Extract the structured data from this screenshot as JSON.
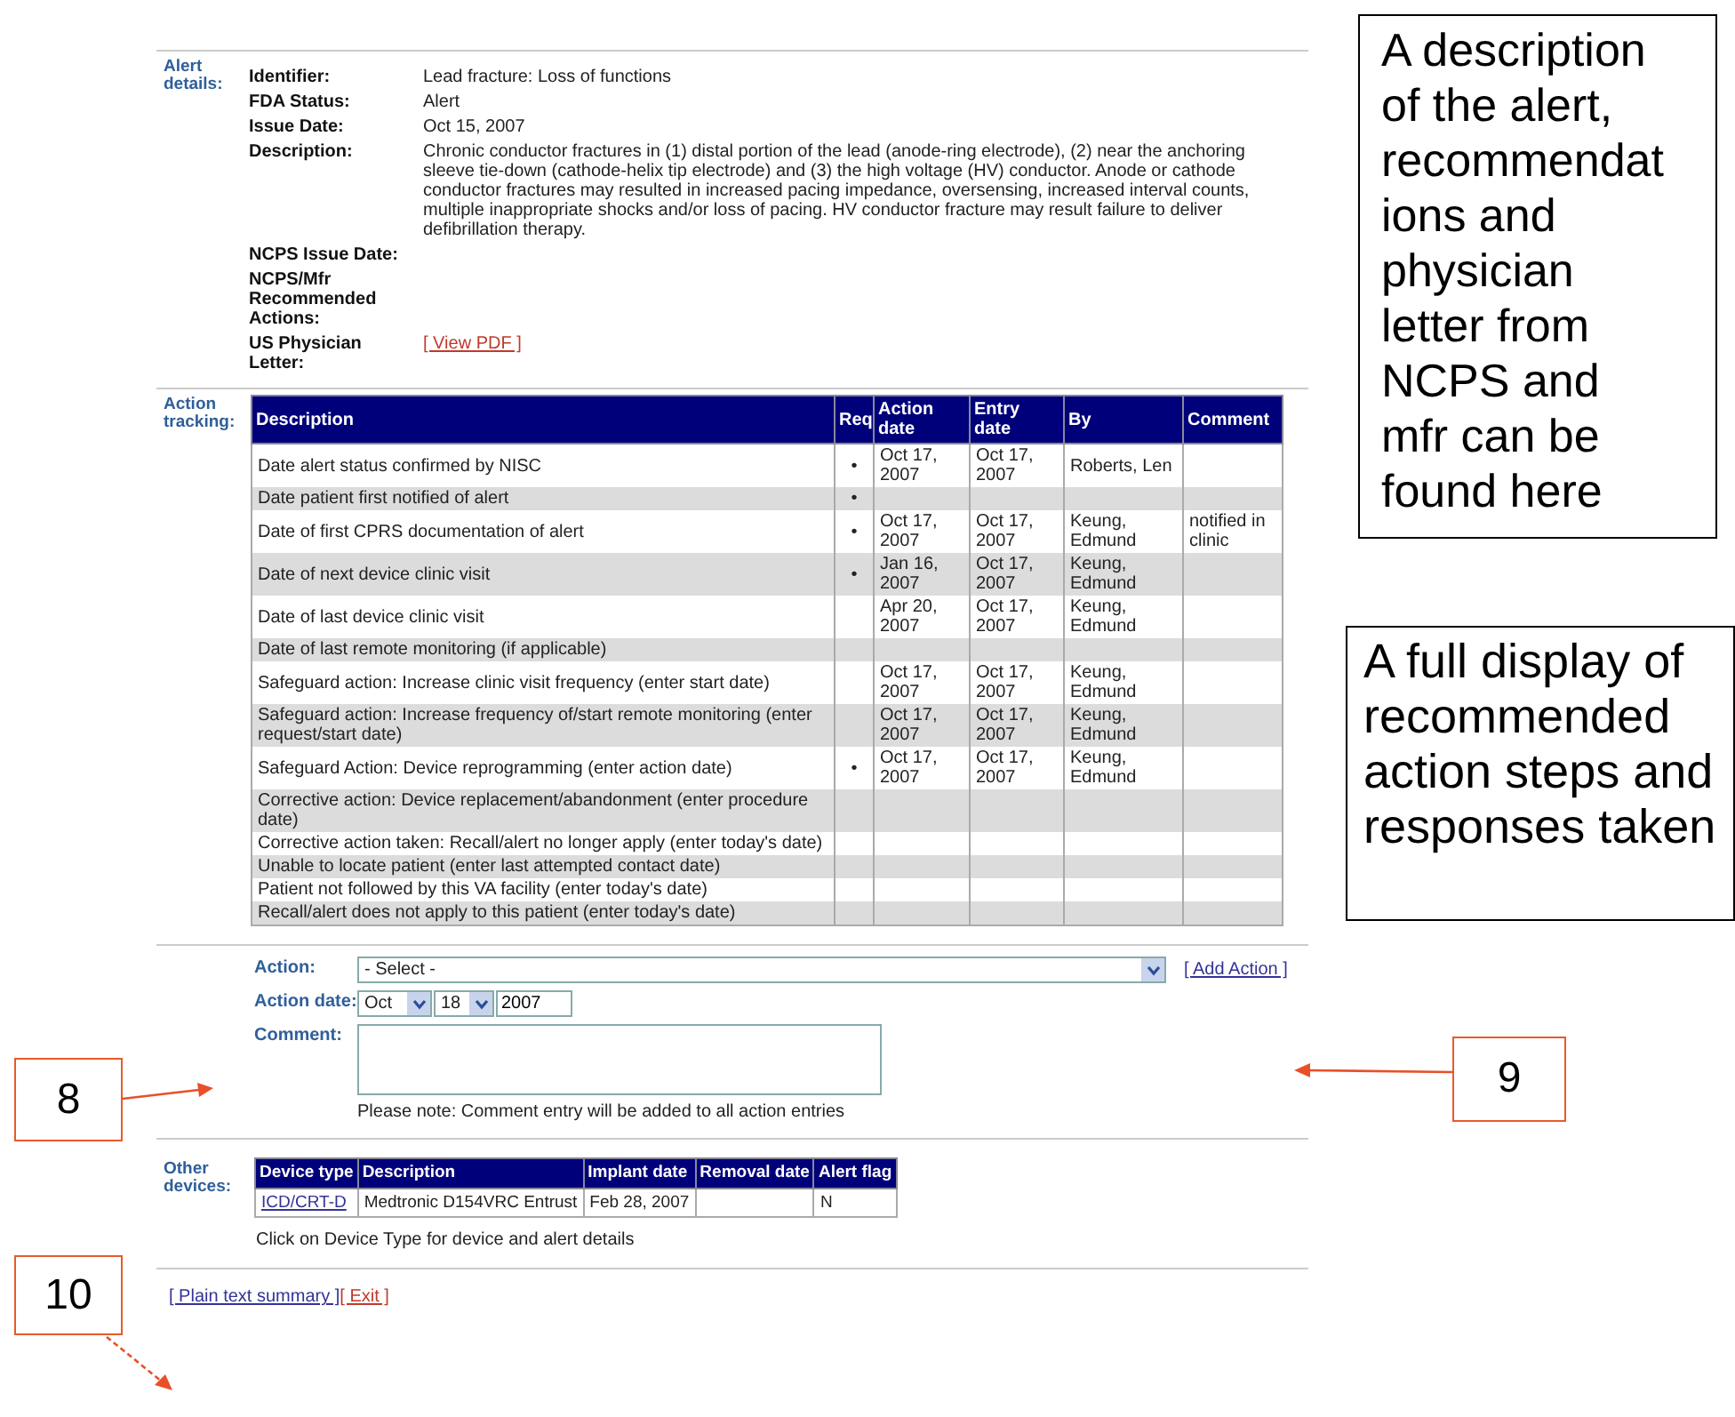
{
  "alert_details": {
    "section_label": "Alert details:",
    "fields": [
      {
        "label": "Identifier:",
        "value": "Lead fracture: Loss of functions",
        "kind": "text"
      },
      {
        "label": "FDA Status:",
        "value": "Alert",
        "kind": "text"
      },
      {
        "label": "Issue Date:",
        "value": "Oct 15, 2007",
        "kind": "text"
      },
      {
        "label": "Description:",
        "value": "Chronic conductor fractures in (1) distal portion of the lead (anode-ring electrode), (2) near the anchoring sleeve tie-down (cathode-helix tip electrode) and (3) the high voltage (HV) conductor. Anode or cathode conductor fractures may resulted in increased pacing impedance, oversensing, increased interval counts, multiple inappropriate shocks and/or loss of pacing. HV conductor fracture may result failure to deliver defibrillation therapy.",
        "kind": "text"
      },
      {
        "label": "NCPS Issue Date:",
        "kind": "text"
      },
      {
        "label": "NCPS/Mfr Recommended Actions:",
        "kind": "text"
      },
      {
        "label": "US Physician Letter:",
        "value": "[ View PDF ]",
        "kind": "link"
      }
    ]
  },
  "action_tracking": {
    "section_label": "Action tracking:",
    "columns": [
      "Description",
      "Req",
      "Action date",
      "Entry date",
      "By",
      "Comment"
    ],
    "rows": [
      {
        "description": "Date alert status confirmed by NISC",
        "req": "•",
        "action_date": "Oct 17, 2007",
        "entry_date": "Oct 17, 2007",
        "by": "Roberts, Len"
      },
      {
        "description": "Date patient first notified of alert",
        "req": "•"
      },
      {
        "description": "Date of first CPRS documentation of alert",
        "req": "•",
        "action_date": "Oct 17, 2007",
        "entry_date": "Oct 17, 2007",
        "by": "Keung, Edmund",
        "comment": "notified in clinic"
      },
      {
        "description": "Date of next device clinic visit",
        "req": "•",
        "action_date": "Jan 16, 2007",
        "entry_date": "Oct 17, 2007",
        "by": "Keung, Edmund"
      },
      {
        "description": "Date of last device clinic visit",
        "action_date": "Apr 20, 2007",
        "entry_date": "Oct 17, 2007",
        "by": "Keung, Edmund"
      },
      {
        "description": "Date of last remote monitoring (if applicable)"
      },
      {
        "description": "Safeguard action: Increase clinic visit frequency (enter start date)",
        "action_date": "Oct 17, 2007",
        "entry_date": "Oct 17, 2007",
        "by": "Keung, Edmund"
      },
      {
        "description": "Safeguard action: Increase frequency of/start remote monitoring (enter request/start date)",
        "action_date": "Oct 17, 2007",
        "entry_date": "Oct 17, 2007",
        "by": "Keung, Edmund"
      },
      {
        "description": "Safeguard Action: Device reprogramming (enter action date)",
        "req": "•",
        "action_date": "Oct 17, 2007",
        "entry_date": "Oct 17, 2007",
        "by": "Keung, Edmund"
      },
      {
        "description": "Corrective action: Device replacement/abandonment (enter procedure date)"
      },
      {
        "description": "Corrective action taken: Recall/alert no longer apply (enter today's date)"
      },
      {
        "description": "Unable to locate patient (enter last attempted contact date)"
      },
      {
        "description": "Patient not followed by this VA facility (enter today's date)"
      },
      {
        "description": "Recall/alert does not apply to this patient (enter today's date)"
      }
    ]
  },
  "action_form": {
    "action_label": "Action:",
    "action_value": "- Select -",
    "add_action": "[ Add Action ]",
    "date_label": "Action date:",
    "month": "Oct",
    "day": "18",
    "year": "2007",
    "comment_label": "Comment:",
    "note": "Please note: Comment entry will be added to all action entries"
  },
  "other_devices": {
    "section_label": "Other devices:",
    "columns": [
      "Device type",
      "Description",
      "Implant date",
      "Removal date",
      "Alert flag"
    ],
    "rows": [
      {
        "device_type": "ICD/CRT-D",
        "description": "Medtronic D154VRC Entrust",
        "implant_date": "Feb 28, 2007",
        "alert_flag": "N"
      }
    ],
    "note": "Click on Device Type for device and alert details"
  },
  "footer_links": [
    {
      "label": "[ Plain text summary ]",
      "kind": "nav"
    },
    {
      "label": "[ Exit ]",
      "kind": "exit"
    }
  ],
  "callouts": [
    {
      "text": "A description of the alert, recommendations and physician letter from NCPS and mfr can be found here",
      "kind": "top"
    },
    {
      "text": "A full display of recommended action steps and responses taken",
      "kind": "middle"
    }
  ],
  "markers": [
    {
      "number": "8"
    },
    {
      "number": "9"
    },
    {
      "number": "10"
    }
  ]
}
